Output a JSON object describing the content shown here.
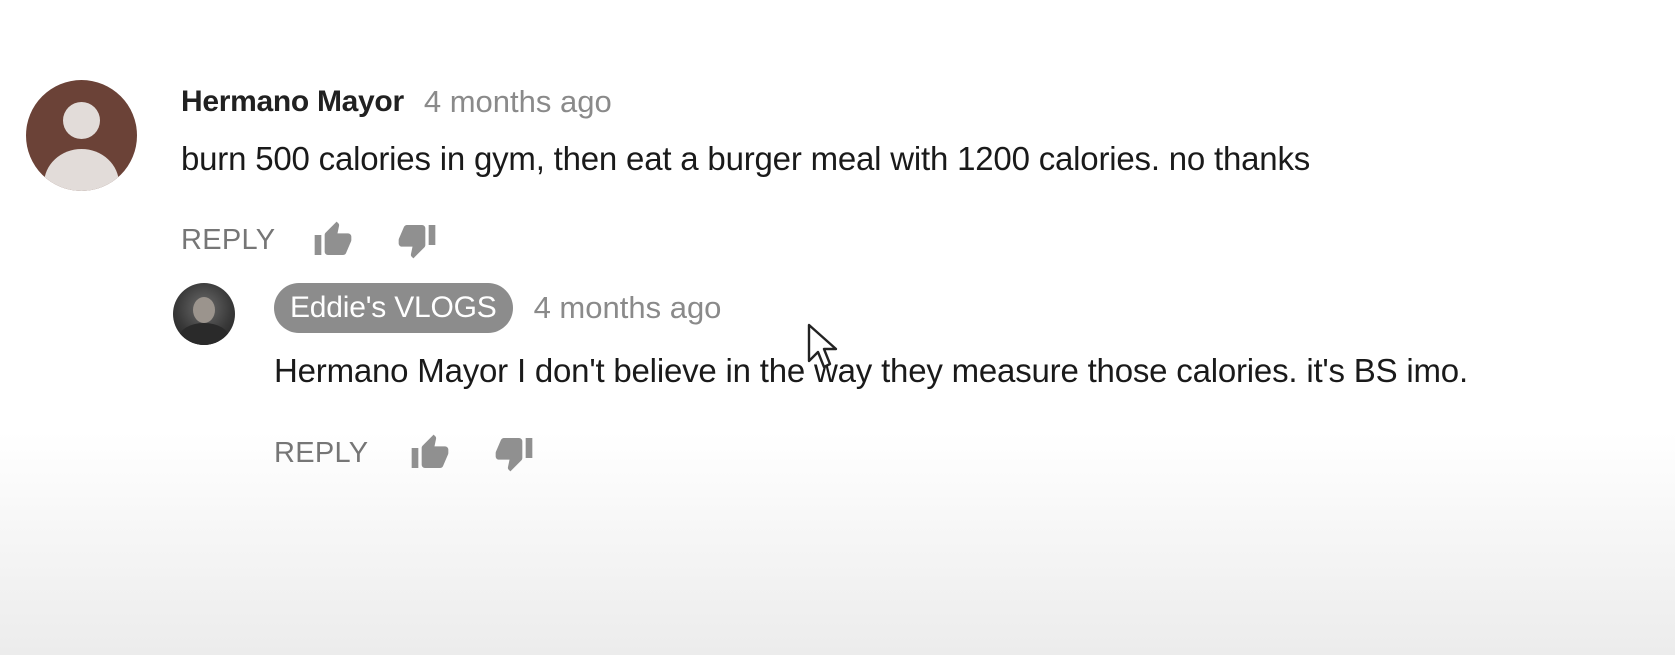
{
  "comment": {
    "author": "Hermano Mayor",
    "timestamp": "4 months ago",
    "text": "burn 500 calories in gym, then eat a burger meal with 1200  calories. no thanks",
    "reply_label": "REPLY",
    "avatar_icon": "default-avatar-icon",
    "avatar_color": "#6b4237"
  },
  "reply": {
    "author": "Eddie's VLOGS",
    "timestamp": "4 months ago",
    "text": "Hermano Mayor I don't believe in the way they measure those calories. it's BS imo.",
    "reply_label": "REPLY",
    "avatar_icon": "channel-avatar-photo",
    "author_badge_color": "#8c8c8c"
  },
  "icons": {
    "like": "thumb-up-icon",
    "dislike": "thumb-down-icon",
    "cursor": "mouse-pointer-icon"
  }
}
